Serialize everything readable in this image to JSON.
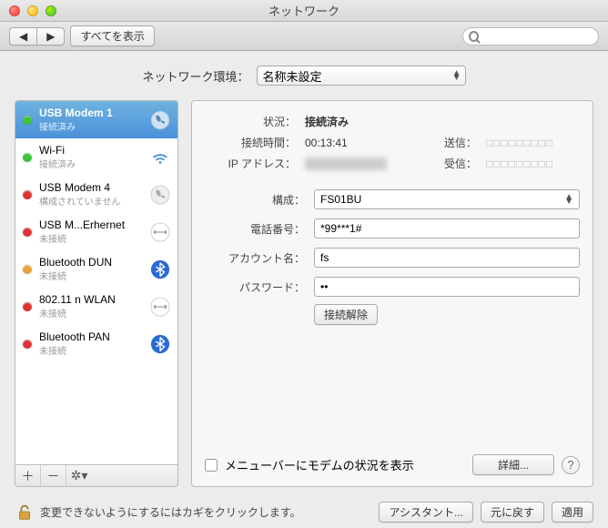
{
  "window": {
    "title": "ネットワーク"
  },
  "toolbar": {
    "show_all": "すべてを表示",
    "search_placeholder": ""
  },
  "location": {
    "label": "ネットワーク環境：",
    "value": "名称未設定"
  },
  "sidebar": {
    "items": [
      {
        "name": "USB Modem 1",
        "status": "接続済み",
        "color": "green",
        "icon": "phone"
      },
      {
        "name": "Wi-Fi",
        "status": "接続済み",
        "color": "green",
        "icon": "wifi"
      },
      {
        "name": "USB Modem 4",
        "status": "構成されていません",
        "color": "red",
        "icon": "phone"
      },
      {
        "name": "USB M...Erhernet",
        "status": "未接続",
        "color": "red",
        "icon": "eth"
      },
      {
        "name": "Bluetooth DUN",
        "status": "未接続",
        "color": "orange",
        "icon": "bt"
      },
      {
        "name": "802.11 n WLAN",
        "status": "未接続",
        "color": "red",
        "icon": "eth"
      },
      {
        "name": "Bluetooth PAN",
        "status": "未接続",
        "color": "red",
        "icon": "bt"
      }
    ]
  },
  "detail": {
    "status_label": "状況：",
    "status_value": "接続済み",
    "time_label": "接続時間：",
    "time_value": "00:13:41",
    "sent_label": "送信：",
    "sent_value": "□□□□□□□□□",
    "ip_label": "IP アドレス：",
    "recv_label": "受信：",
    "recv_value": "□□□□□□□□□",
    "config_label": "構成：",
    "config_value": "FS01BU",
    "phone_label": "電話番号：",
    "phone_value": "*99***1#",
    "account_label": "アカウント名：",
    "account_value": "fs",
    "password_label": "パスワード：",
    "password_value": "••",
    "disconnect": "接続解除",
    "menubar_checkbox": "メニューバーにモデムの状況を表示",
    "advanced": "詳細..."
  },
  "footer": {
    "lock_text": "変更できないようにするにはカギをクリックします。",
    "assistant": "アシスタント...",
    "revert": "元に戻す",
    "apply": "適用"
  }
}
